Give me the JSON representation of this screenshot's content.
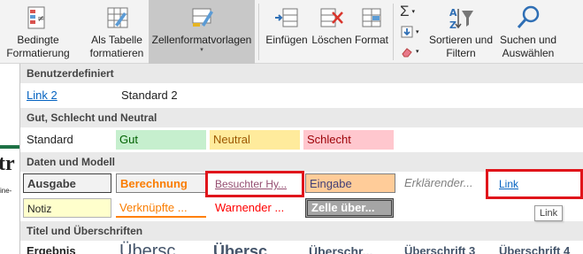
{
  "ribbon": {
    "conditional_format": {
      "line1": "Bedingte",
      "line2": "Formatierung"
    },
    "format_as_table": {
      "line1": "Als Tabelle",
      "line2": "formatieren"
    },
    "cell_styles": {
      "label": "Zellenformatvorlagen"
    },
    "insert": {
      "label": "Einfügen"
    },
    "delete": {
      "label": "Löschen"
    },
    "format": {
      "label": "Format"
    },
    "sort_filter": {
      "line1": "Sortieren und",
      "line2": "Filtern"
    },
    "find_select": {
      "line1": "Suchen und",
      "line2": "Auswählen"
    },
    "autosum_symbol": "Σ",
    "caret": "▾"
  },
  "sheet": {
    "fragment_big": "tr",
    "fragment_small": "ine-"
  },
  "gallery": {
    "sections": {
      "custom": "Benutzerdefiniert",
      "good_bad": "Gut, Schlecht und Neutral",
      "data_model": "Daten und Modell",
      "titles": "Titel und Überschriften"
    },
    "custom_styles": [
      "Link 2",
      "Standard 2"
    ],
    "good_bad_styles": [
      "Standard",
      "Gut",
      "Neutral",
      "Schlecht"
    ],
    "data_row1": [
      "Ausgabe",
      "Berechnung",
      "Besuchter Hy...",
      "Eingabe",
      "Erklärender...",
      "Link"
    ],
    "data_row2": [
      "Notiz",
      "Verknüpfte ...",
      "Warnender ...",
      "Zelle über..."
    ],
    "title_styles": [
      "Ergebnis",
      "Übersc...",
      "Übersc...",
      "Überschr...",
      "Überschrift 3",
      "Überschrift 4"
    ]
  },
  "tooltip": "Link",
  "colors": {
    "good_bg": "#c6efce",
    "good_fg": "#006100",
    "neutral_bg": "#ffeb9c",
    "neutral_fg": "#9c5700",
    "bad_bg": "#ffc7ce",
    "bad_fg": "#9c0006",
    "input_bg": "#ffcc99",
    "calc_fg": "#fa7d00",
    "highlight": "#e0151b",
    "link": "#0563c1",
    "visited": "#954f72"
  }
}
